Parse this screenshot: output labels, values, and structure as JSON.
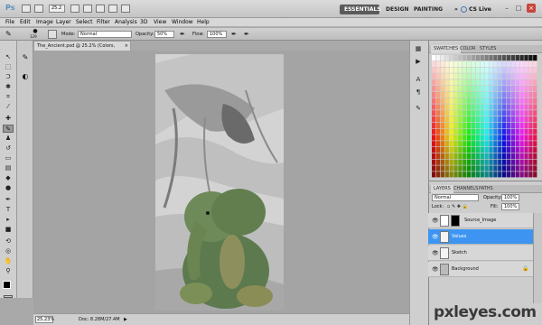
{
  "app": {
    "logo": "Ps",
    "zoom_value": "25.2"
  },
  "workspaces": {
    "essentials": "ESSENTIALS",
    "design": "DESIGN",
    "painting": "PAINTING",
    "more": "»",
    "cslive": "CS Live"
  },
  "window_buttons": {
    "minimize": "–",
    "restore": "□",
    "close": "×"
  },
  "menu": [
    "File",
    "Edit",
    "Image",
    "Layer",
    "Select",
    "Filter",
    "Analysis",
    "3D",
    "View",
    "Window",
    "Help"
  ],
  "options": {
    "brush_size": "129",
    "mode_label": "Mode:",
    "mode_value": "Normal",
    "opacity_label": "Opacity:",
    "opacity_value": "50%",
    "flow_label": "Flow:",
    "flow_value": "100%"
  },
  "document": {
    "tab_title": "The_Ancient.psd @ 25.2% (Colors, RGB/8)",
    "close_x": "×"
  },
  "status": {
    "zoom": "25.23%",
    "doc": "Doc: 8.28M/27.4M"
  },
  "panels": {
    "tabs": [
      "SWATCHES",
      "COLOR",
      "STYLES"
    ],
    "layer_tabs": [
      "LAYERS",
      "CHANNELS",
      "PATHS"
    ]
  },
  "layers": {
    "blend_mode": "Normal",
    "opacity_label": "Opacity:",
    "opacity_value": "100%",
    "lock_label": "Lock:",
    "fill_label": "Fill:",
    "fill_value": "100%",
    "items": [
      {
        "name": "Source_Image"
      },
      {
        "name": "Values"
      },
      {
        "name": "Sketch"
      },
      {
        "name": "Background"
      }
    ]
  },
  "watermark": "pxleyes.com",
  "colors": {
    "selected_layer": "#3d95f1",
    "essentials_bg": "#5b5b5b",
    "fg_swatch": "#000000",
    "bg_swatch": "#ffffff"
  }
}
